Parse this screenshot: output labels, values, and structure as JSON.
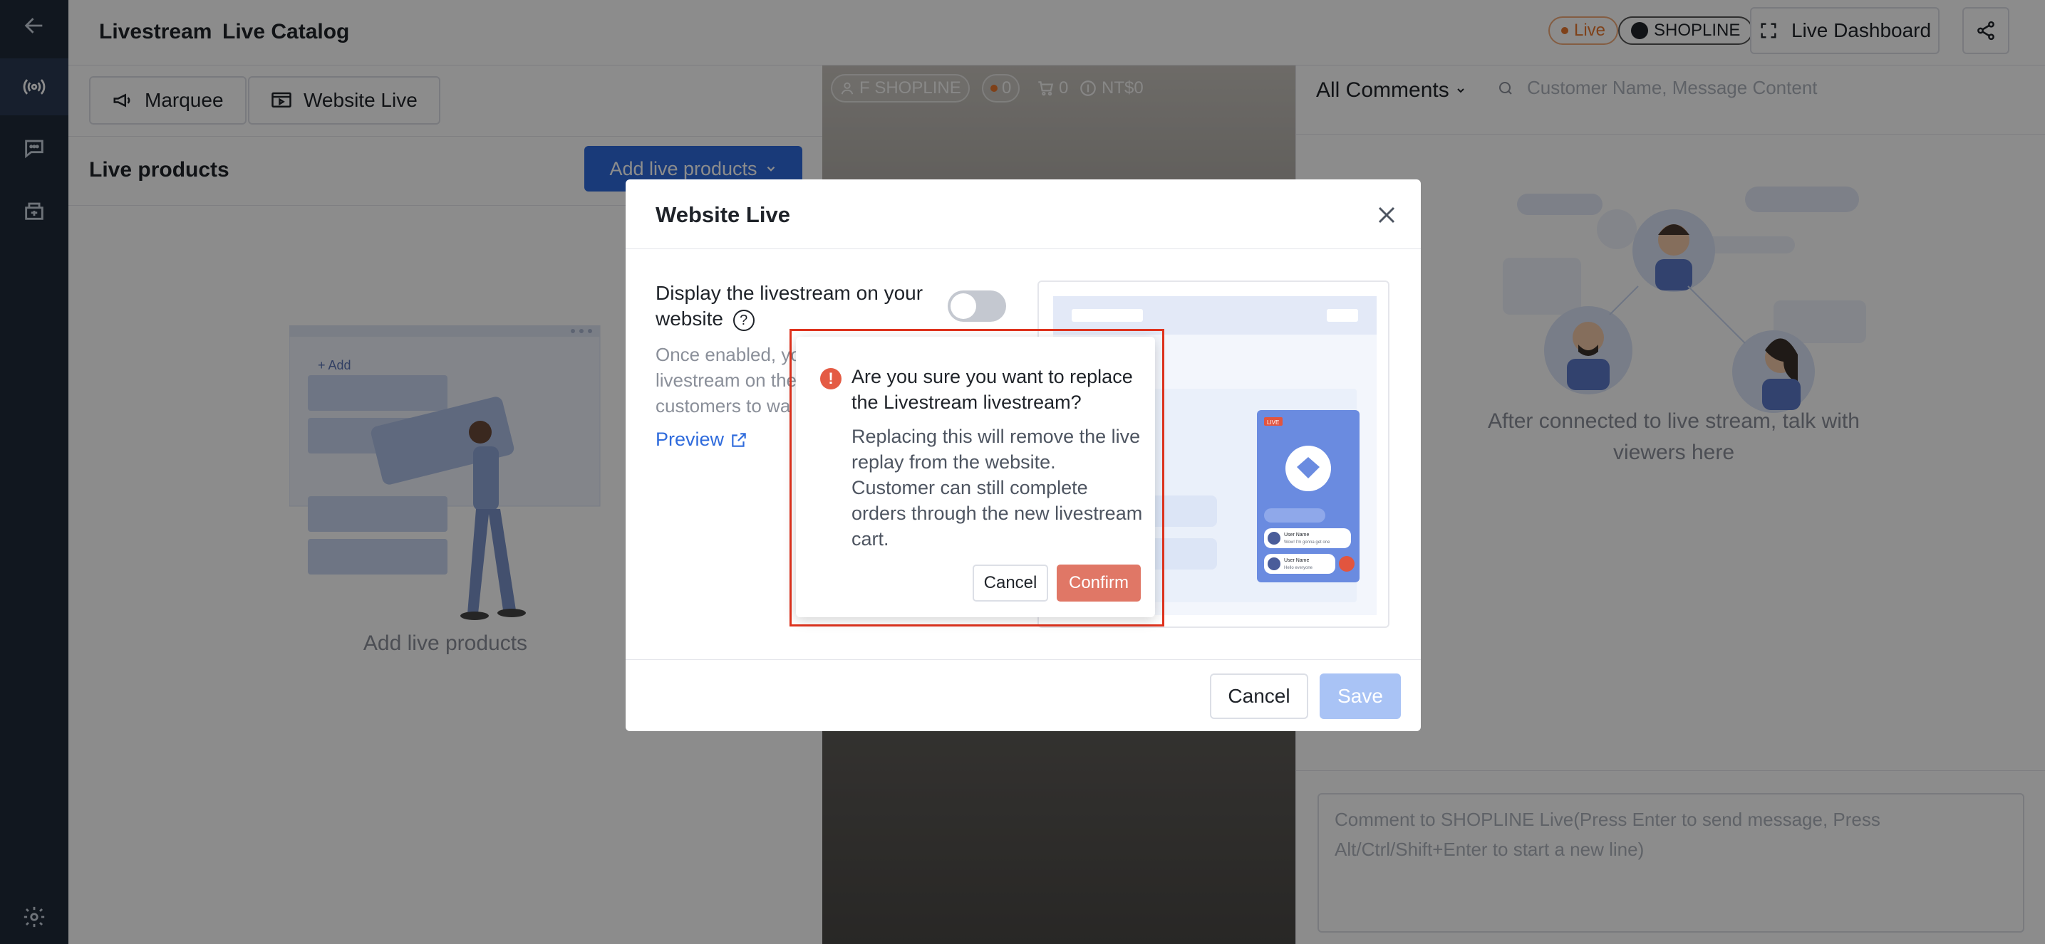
{
  "header": {
    "crumb_1": "Livestream",
    "crumb_2": "Live Catalog",
    "live_badge": "Live",
    "store_badge": "SHOPLINE",
    "dashboard_label": "Live Dashboard"
  },
  "left_panel": {
    "tabs": [
      {
        "label": "Marquee"
      },
      {
        "label": "Website Live"
      }
    ],
    "title": "Live products",
    "add_button": "Add live products",
    "empty_text": "Add live products",
    "illustration_label": "+ Add"
  },
  "video": {
    "stats": [
      "F SHOPLINE",
      "0",
      "0",
      "NT$0"
    ]
  },
  "right_panel": {
    "filter": "All Comments",
    "search_placeholder": "Customer Name, Message Content",
    "empty_text": "After connected to live stream, talk with viewers here",
    "comment_placeholder": "Comment to SHOPLINE Live(Press Enter to send message, Press Alt/Ctrl/Shift+Enter to start a new line)"
  },
  "modal": {
    "title": "Website Live",
    "setting_label": "Display the livestream on your website",
    "help": "?",
    "desc_lines": [
      "Once enabled, yo",
      "livestream on the",
      "customers to wa"
    ],
    "preview_link": "Preview",
    "cancel": "Cancel",
    "save": "Save",
    "preview_live_tag": "LIVE",
    "preview_user_1": "User Name",
    "preview_msg_1": "Wow! I'm gonna get one",
    "preview_user_2": "User Name",
    "preview_msg_2": "Hello everyone"
  },
  "confirm": {
    "icon": "!",
    "title": "Are you sure you want to replace the Livestream livestream?",
    "body": "Replacing this will remove the live replay from the website. Customer can still complete orders through the new livestream cart.",
    "cancel": "Cancel",
    "confirm": "Confirm"
  },
  "colors": {
    "primary": "#2f6bdc",
    "danger": "#e45b44",
    "rail": "#1f2a3a"
  }
}
